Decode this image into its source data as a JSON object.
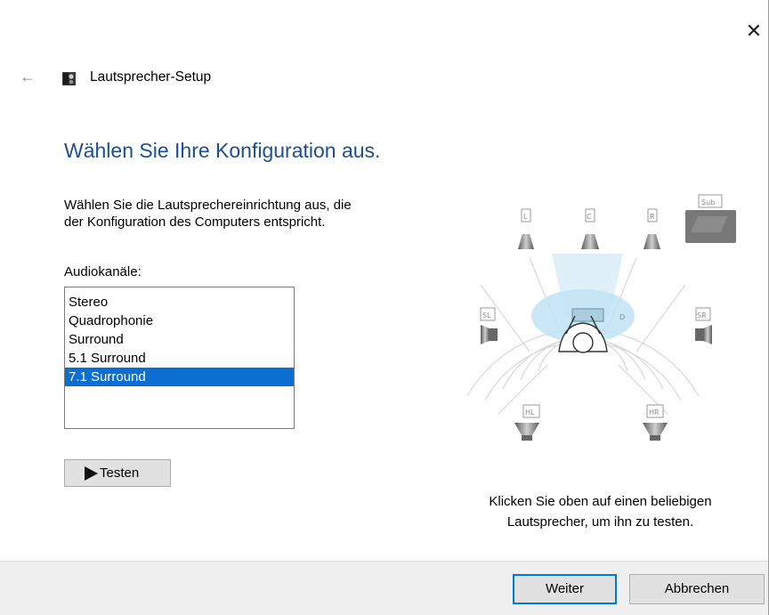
{
  "window": {
    "title": "Lautsprecher-Setup",
    "close_glyph": "✕",
    "back_glyph": "←"
  },
  "main": {
    "heading": "Wählen Sie Ihre Konfiguration aus.",
    "description_lines": [
      "Wählen Sie die Lautsprechereinrichtung aus, die",
      "der Konfiguration des Computers entspricht."
    ],
    "channels_label": "Audiokanäle:",
    "channels": [
      "Stereo",
      "Quadrophonie",
      "Surround",
      "5.1 Surround",
      "7.1 Surround"
    ],
    "selected_channel": "7.1 Surround",
    "test_button": "Testen"
  },
  "diagram": {
    "speakers": [
      "L",
      "C",
      "R",
      "Sub",
      "SL",
      "SR",
      "HL",
      "HR"
    ]
  },
  "hint_lines": [
    "Klicken Sie oben auf einen beliebigen",
    "Lautsprecher, um ihn zu testen."
  ],
  "footer": {
    "next_label": "Weiter",
    "cancel_label": "Abbrechen"
  },
  "colors": {
    "heading": "#1b4f92",
    "selection": "#0a6fd1",
    "footer_bg": "#f0f0f0",
    "default_button_border": "#0078d7"
  }
}
